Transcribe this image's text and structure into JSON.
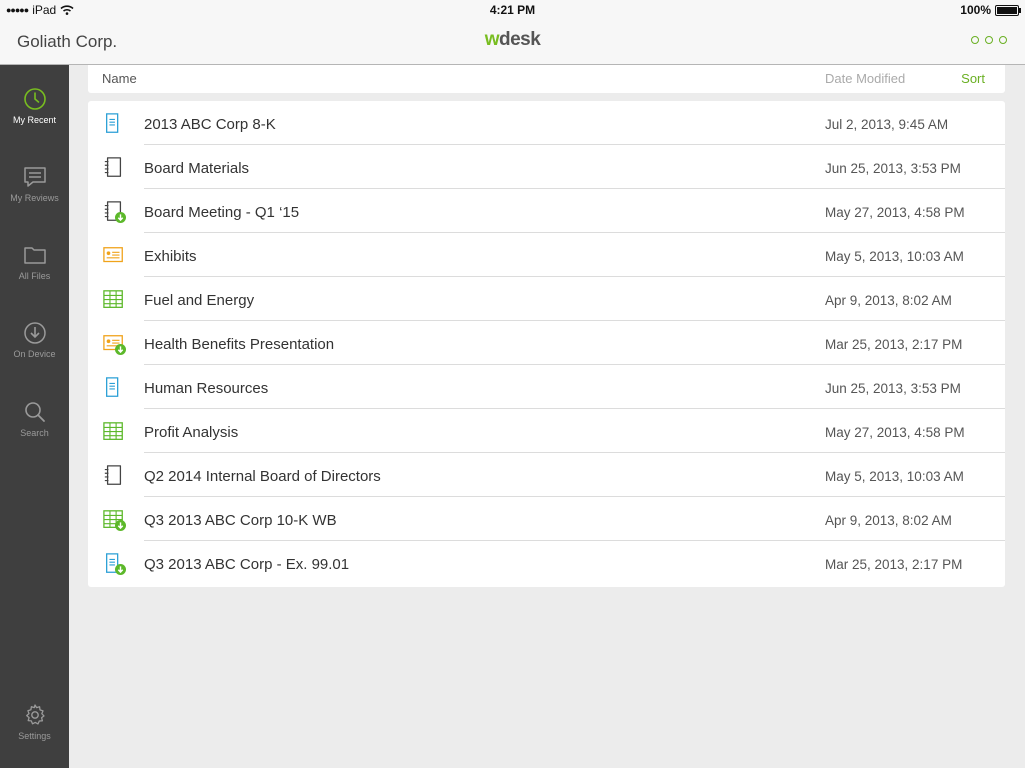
{
  "statusbar": {
    "carrier": "iPad",
    "time": "4:21 PM",
    "battery": "100%"
  },
  "navbar": {
    "company": "Goliath Corp.",
    "logo_prefix": "w",
    "logo_suffix": "desk"
  },
  "sidebar": {
    "items": [
      {
        "label": "My Recent",
        "icon": "clock-icon"
      },
      {
        "label": "My Reviews",
        "icon": "chat-icon"
      },
      {
        "label": "All Files",
        "icon": "folder-icon"
      },
      {
        "label": "On Device",
        "icon": "download-icon"
      },
      {
        "label": "Search",
        "icon": "search-icon"
      },
      {
        "label": "Settings",
        "icon": "gear-icon"
      }
    ]
  },
  "list_header": {
    "name": "Name",
    "date": "Date Modified",
    "sort": "Sort"
  },
  "colors": {
    "accent": "#6ab023",
    "doc_blue": "#2a9fd6",
    "presentation_orange": "#f0a31a",
    "spreadsheet_green": "#5cb82a"
  },
  "files": [
    {
      "name": "2013 ABC Corp 8-K",
      "date": "Jul 2, 2013, 9:45 AM",
      "type": "document",
      "on_device": false
    },
    {
      "name": "Board Materials",
      "date": "Jun 25, 2013, 3:53 PM",
      "type": "book",
      "on_device": false
    },
    {
      "name": "Board Meeting - Q1 ‘15",
      "date": "May 27, 2013, 4:58 PM",
      "type": "book",
      "on_device": true
    },
    {
      "name": "Exhibits",
      "date": "May 5, 2013, 10:03 AM",
      "type": "presentation",
      "on_device": false
    },
    {
      "name": "Fuel and Energy",
      "date": "Apr 9, 2013, 8:02 AM",
      "type": "spreadsheet",
      "on_device": false
    },
    {
      "name": "Health Benefits Presentation",
      "date": "Mar 25, 2013, 2:17 PM",
      "type": "presentation",
      "on_device": true
    },
    {
      "name": "Human Resources",
      "date": "Jun 25, 2013, 3:53 PM",
      "type": "document",
      "on_device": false
    },
    {
      "name": "Profit Analysis",
      "date": "May 27, 2013, 4:58 PM",
      "type": "spreadsheet",
      "on_device": false
    },
    {
      "name": "Q2 2014 Internal Board of Directors",
      "date": "May 5, 2013, 10:03 AM",
      "type": "book",
      "on_device": false
    },
    {
      "name": "Q3 2013 ABC Corp 10-K WB",
      "date": "Apr 9, 2013, 8:02 AM",
      "type": "spreadsheet",
      "on_device": true
    },
    {
      "name": "Q3 2013 ABC Corp - Ex. 99.01",
      "date": "Mar 25, 2013, 2:17 PM",
      "type": "document",
      "on_device": true
    }
  ]
}
